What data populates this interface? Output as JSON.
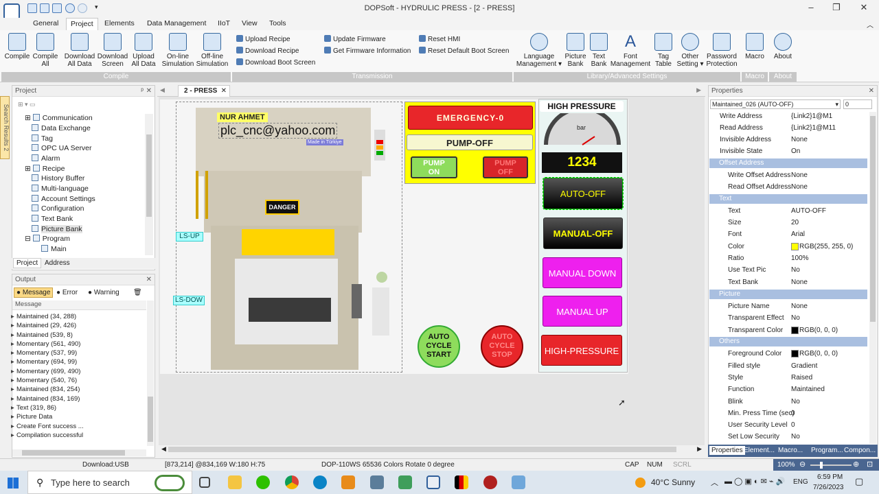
{
  "window": {
    "title": "DOPSoft - HYDRULIC PRESS - [2 - PRESS]"
  },
  "menu": {
    "tabs": [
      "General",
      "Project",
      "Elements",
      "Data Management",
      "IIoT",
      "View",
      "Tools"
    ],
    "active": "Project"
  },
  "ribbon": {
    "buttons": [
      {
        "l1": "Compile",
        "l2": ""
      },
      {
        "l1": "Compile",
        "l2": "All"
      },
      {
        "l1": "Download",
        "l2": "All Data"
      },
      {
        "l1": "Download",
        "l2": "Screen"
      },
      {
        "l1": "Upload",
        "l2": "All Data"
      },
      {
        "l1": "On-line",
        "l2": "Simulation"
      },
      {
        "l1": "Off-line",
        "l2": "Simulation"
      }
    ],
    "transmission": [
      "Upload Recipe",
      "Download Recipe",
      "Download Boot Screen",
      "Update Firmware",
      "Get Firmware Information",
      "Reset HMI",
      "Reset Default Boot Screen"
    ],
    "lib_buttons": [
      {
        "l1": "Language",
        "l2": "Management ▾"
      },
      {
        "l1": "Picture",
        "l2": "Bank"
      },
      {
        "l1": "Text",
        "l2": "Bank"
      },
      {
        "l1": "Font",
        "l2": "Management"
      },
      {
        "l1": "Tag",
        "l2": "Table"
      },
      {
        "l1": "Other",
        "l2": "Setting ▾"
      },
      {
        "l1": "Password",
        "l2": "Protection"
      }
    ],
    "macro_button": "Macro",
    "about_button": "About",
    "groups": {
      "compile": "Compile",
      "transmission": "Transmission",
      "library": "Library/Advanced Settings",
      "macro": "Macro",
      "about": "About"
    }
  },
  "search_results_tab": "Search Results 2",
  "project_panel": {
    "title": "Project",
    "items": [
      "Communication",
      "Data Exchange",
      "Tag",
      "OPC UA Server",
      "Alarm",
      "Recipe",
      "History Buffer",
      "Multi-language",
      "Account Settings",
      "Configuration",
      "Text Bank",
      "Picture Bank",
      "Program",
      "Main"
    ],
    "tabs": [
      "Project",
      "Address"
    ]
  },
  "output_panel": {
    "title": "Output",
    "filters": [
      "Message",
      "Error",
      "Warning"
    ],
    "column": "Message",
    "items": [
      "Maintained (34, 288)",
      "Maintained (29, 426)",
      "Maintained (539, 8)",
      "Momentary (561, 490)",
      "Momentary (537, 99)",
      "Momentary (694, 99)",
      "Momentary (699, 490)",
      "Momentary (540, 76)",
      "Maintained (834, 254)",
      "Maintained (834, 169)",
      "Text (319, 86)",
      "Picture Data",
      "Create Font success ...",
      "Compilation successful"
    ]
  },
  "doc_tab": "2 - PRESS",
  "hmi": {
    "label_name": "NUR AHMET",
    "label_email": "plc_cnc@yahoo.com",
    "label_made": "Made in Türkiye",
    "danger": "DANGER",
    "ls_up": "LS-UP",
    "ls_down": "LS-DOW",
    "emergency": "EMERGENCY-0",
    "pump_state": "PUMP-OFF",
    "pump_on": [
      "PUMP",
      "ON"
    ],
    "pump_off": [
      "PUMP",
      "OFF"
    ],
    "high_pressure_title": "HIGH  PRESSURE",
    "gauge_unit": "bar",
    "pressure_value": "1234",
    "auto_off": "AUTO-OFF",
    "manual_off": "MANUAL-OFF",
    "manual_down": "MANUAL DOWN",
    "manual_up": "MANUAL UP",
    "high_pressure_btn": "HIGH-PRESSURE",
    "auto_start": [
      "AUTO",
      "CYCLE",
      "START"
    ],
    "auto_stop": [
      "AUTO",
      "CYCLE",
      "STOP"
    ]
  },
  "properties": {
    "title": "Properties",
    "selector": "Maintained_026 (AUTO-OFF)",
    "selector_num": "0",
    "rows_top": [
      {
        "name": "Write Address",
        "value": "{Link2}1@M1"
      },
      {
        "name": "Read Address",
        "value": "{Link2}1@M11"
      },
      {
        "name": "Invisible Address",
        "value": "None"
      },
      {
        "name": "Invisible State",
        "value": "On"
      }
    ],
    "sections": {
      "offset": "Offset Address",
      "text": "Text",
      "picture": "Picture",
      "others": "Others"
    },
    "rows_offset": [
      {
        "name": "Write Offset Address",
        "value": "None"
      },
      {
        "name": "Read Offset Address",
        "value": "None"
      }
    ],
    "rows_text": [
      {
        "name": "Text",
        "value": "AUTO-OFF"
      },
      {
        "name": "Size",
        "value": "20"
      },
      {
        "name": "Font",
        "value": "Arial"
      },
      {
        "name": "Color",
        "value": "RGB(255, 255, 0)"
      },
      {
        "name": "Ratio",
        "value": "100%"
      },
      {
        "name": "Use Text Pic",
        "value": "No"
      },
      {
        "name": "Text Bank",
        "value": "None"
      }
    ],
    "rows_picture": [
      {
        "name": "Picture Name",
        "value": "None"
      },
      {
        "name": "Transparent Effect",
        "value": "No"
      },
      {
        "name": "Transparent Color",
        "value": "RGB(0, 0, 0)"
      }
    ],
    "rows_others": [
      {
        "name": "Foreground Color",
        "value": "RGB(0, 0, 0)"
      },
      {
        "name": "Filled style",
        "value": "Gradient"
      },
      {
        "name": "Style",
        "value": "Raised"
      },
      {
        "name": "Function",
        "value": "Maintained"
      },
      {
        "name": "Blink",
        "value": "No"
      },
      {
        "name": "Min. Press Time (sec)",
        "value": "0"
      },
      {
        "name": "User Security Level",
        "value": "0"
      },
      {
        "name": "Set Low Security",
        "value": "No"
      }
    ],
    "bottom_tabs": [
      "Properties",
      "Element...",
      "Macro...",
      "Program...",
      "Compon..."
    ]
  },
  "status": {
    "download": "Download:USB",
    "coords": "[873,214] @834,169 W:180 H:75",
    "device": "DOP-110WS 65536 Colors Rotate 0 degree",
    "cap": "CAP",
    "num": "NUM",
    "scrl": "SCRL",
    "zoom": "100%"
  },
  "taskbar": {
    "search_placeholder": "Type here to search",
    "weather": "40°C  Sunny",
    "lang": "ENG",
    "time": "6:59 PM",
    "date": "7/26/2023"
  },
  "colors": {
    "accent": "#2b579a",
    "section": "#a9bfe0",
    "yellow": "#ffff00",
    "emergency": "#e8262a",
    "magenta": "#ff00ff"
  }
}
